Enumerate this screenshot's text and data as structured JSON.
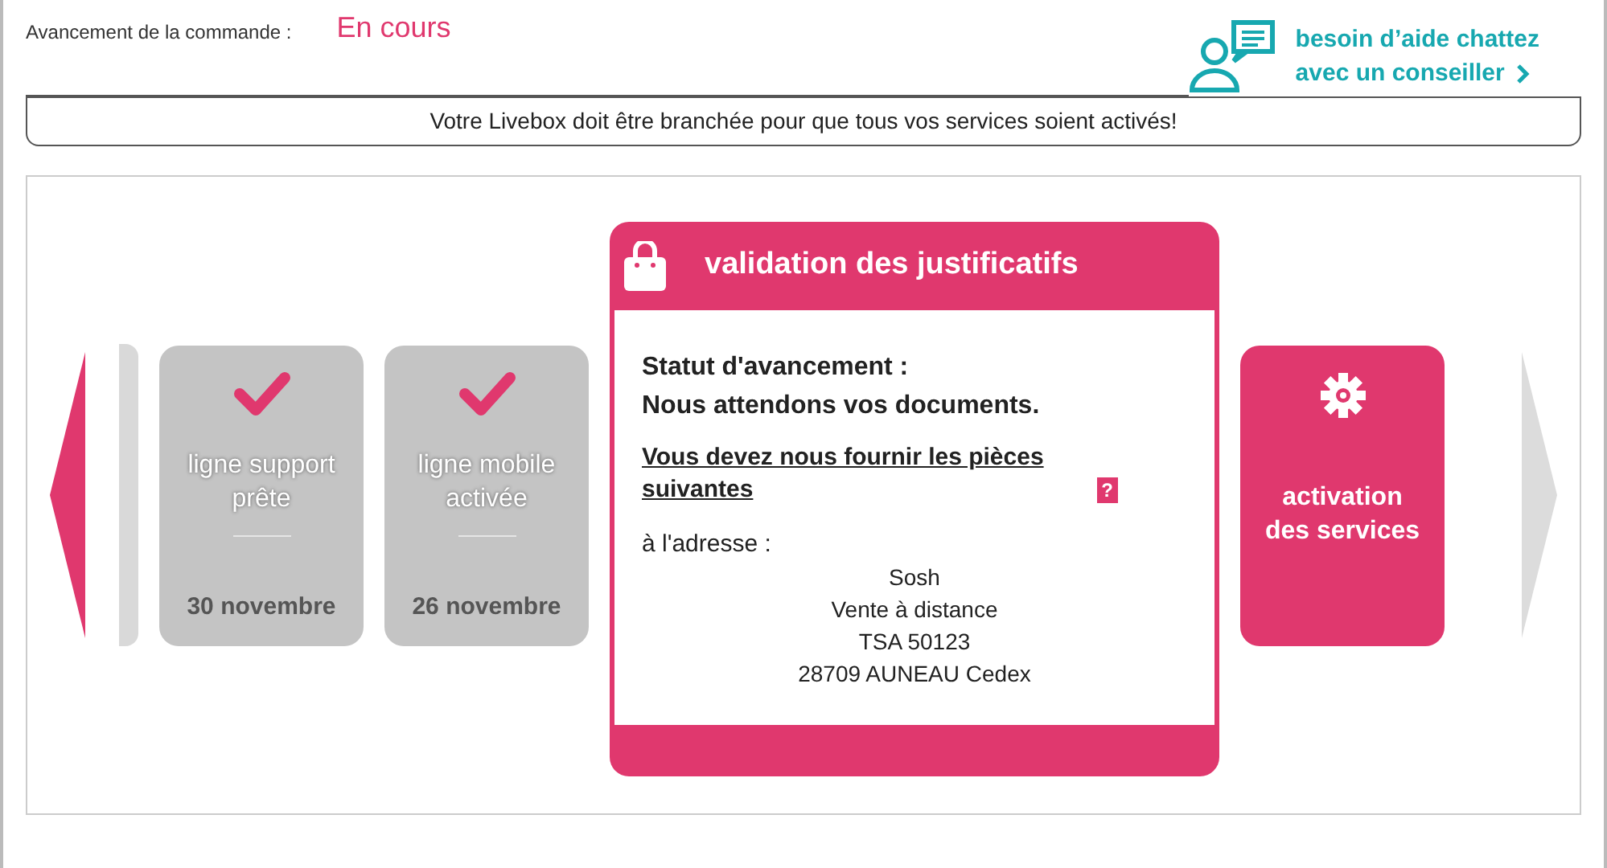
{
  "order_progress": {
    "label": "Avancement de la commande :",
    "status": "En cours"
  },
  "help": {
    "line1": "besoin d’aide chattez",
    "line2": "avec un conseiller"
  },
  "notice": "Votre Livebox doit être branchée pour que tous vos services soient activés!",
  "carousel": {
    "prev_arrow": {
      "disabled": false
    },
    "next_arrow": {
      "disabled": true
    },
    "steps": [
      {
        "kind": "partial"
      },
      {
        "kind": "done",
        "title": "ligne support prête",
        "date": "30 novembre"
      },
      {
        "kind": "done",
        "title": "ligne mobile activée",
        "date": "26 novembre"
      },
      {
        "kind": "current",
        "title": "validation des justificatifs",
        "status_label": "Statut d'avancement :",
        "status_text": "Nous attendons vos documents.",
        "link": "Vous devez nous fournir les pièces suivantes",
        "help_mark": "?",
        "address_label": "à l'adresse :",
        "address_lines": [
          "Sosh",
          "Vente à distance",
          "TSA 50123",
          "28709 AUNEAU Cedex"
        ]
      },
      {
        "kind": "upcoming",
        "title": "activation des services"
      }
    ]
  }
}
